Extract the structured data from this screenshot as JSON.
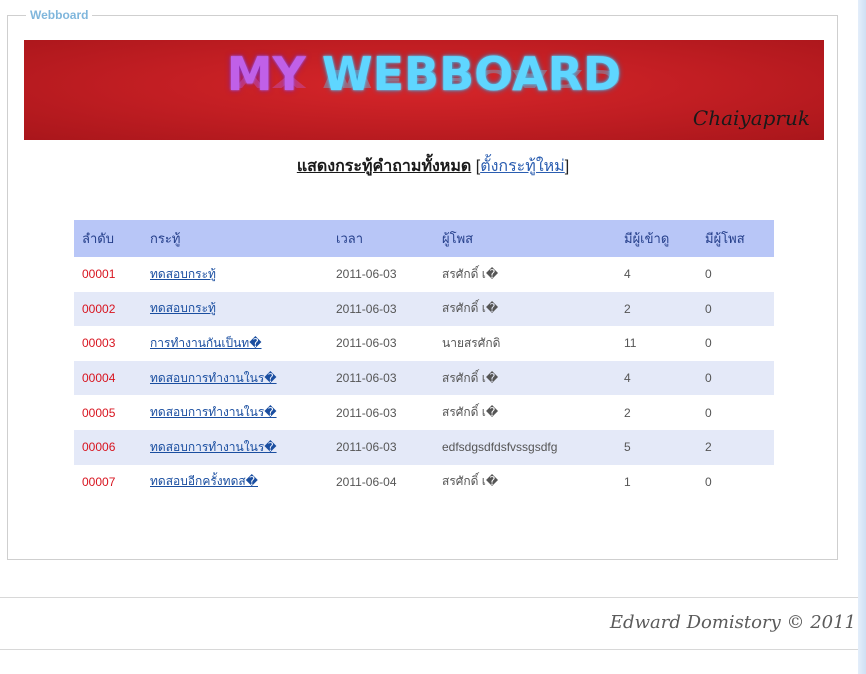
{
  "fieldset": {
    "legend": "Webboard"
  },
  "banner": {
    "title_part1": "MY",
    "title_part2": "WEBBOARD",
    "subtitle": "Chaiyapruk"
  },
  "heading": {
    "title": "แสดงกระทู้คำถามทั้งหมด",
    "bracket_open": "[",
    "new_topic_link": "ตั้งกระทู้ใหม่",
    "bracket_close": "]"
  },
  "table": {
    "columns": [
      "ลำดับ",
      "กระทู้",
      "เวลา",
      "ผู้โพส",
      "มีผู้เข้าดู",
      "มีผู้โพส"
    ],
    "rows": [
      {
        "id": "00001",
        "topic": "ทดสอบกระทู้",
        "date": "2011-06-03",
        "poster": "สรศักดิ์ เ�",
        "views": "4",
        "replies": "0"
      },
      {
        "id": "00002",
        "topic": "ทดสอบกระทู้",
        "date": "2011-06-03",
        "poster": "สรศักดิ์ เ�",
        "views": "2",
        "replies": "0"
      },
      {
        "id": "00003",
        "topic": "การทำงานกันเป็นท�",
        "date": "2011-06-03",
        "poster": "นายสรศักดิ",
        "views": "11",
        "replies": "0"
      },
      {
        "id": "00004",
        "topic": "ทดสอบการทำงานในร�",
        "date": "2011-06-03",
        "poster": "สรศักดิ์ เ�",
        "views": "4",
        "replies": "0"
      },
      {
        "id": "00005",
        "topic": "ทดสอบการทำงานในร�",
        "date": "2011-06-03",
        "poster": "สรศักดิ์ เ�",
        "views": "2",
        "replies": "0"
      },
      {
        "id": "00006",
        "topic": "ทดสอบการทำงานในร�",
        "date": "2011-06-03",
        "poster": "edfsdgsdfdsfvssgsdfg",
        "views": "5",
        "replies": "2"
      },
      {
        "id": "00007",
        "topic": "ทดสอบอีกครั้งทดส�",
        "date": "2011-06-04",
        "poster": "สรศักดิ์ เ�",
        "views": "1",
        "replies": "0"
      }
    ]
  },
  "footer": {
    "text": "Edward Domistory © 2011"
  },
  "colors": {
    "banner_red": "#bf1d22",
    "table_header": "#b8c6f7",
    "row_alt": "#e4e9f8",
    "id_red": "#d8141f",
    "link_blue": "#1a4ea0"
  }
}
